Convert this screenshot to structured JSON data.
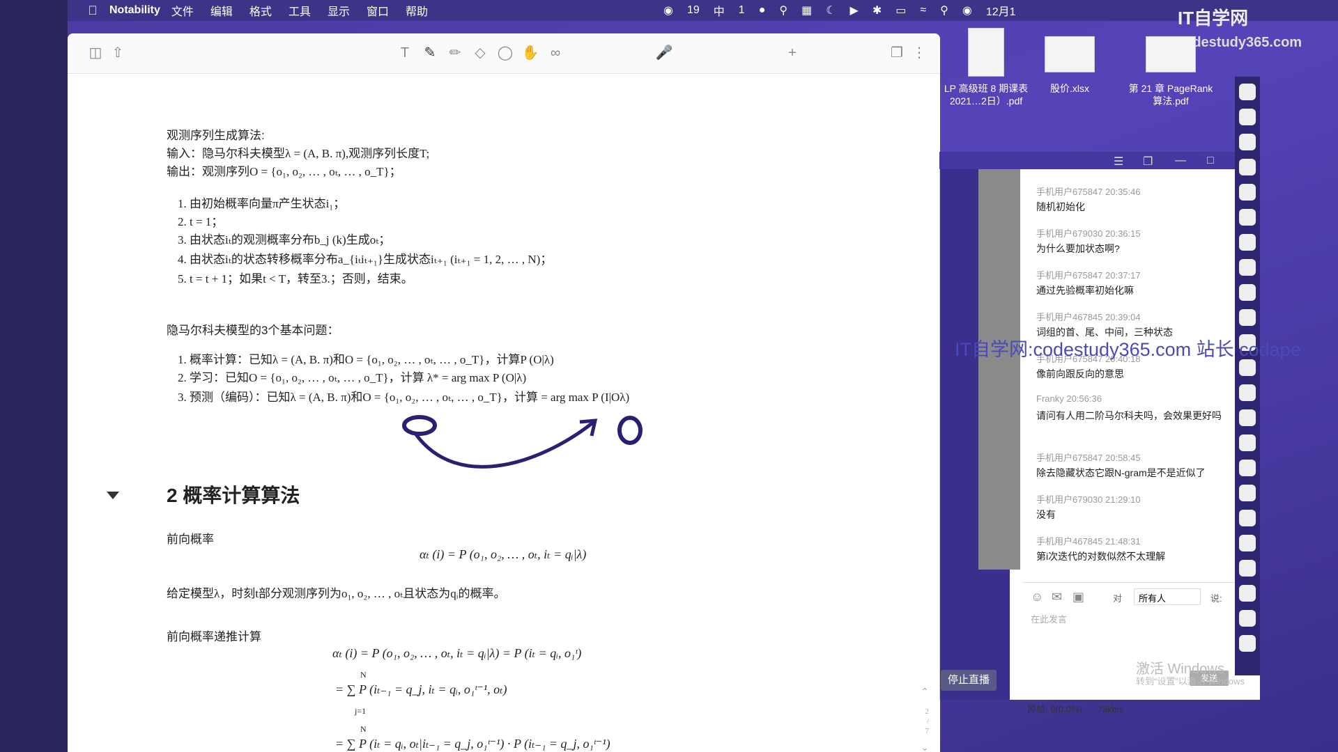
{
  "menubar": {
    "app": "Notability",
    "items": [
      "文件",
      "编辑",
      "格式",
      "工具",
      "显示",
      "窗口",
      "帮助"
    ],
    "status": {
      "wechat": "19",
      "ime": "中",
      "num": "1",
      "date": "12月1"
    }
  },
  "desktop": {
    "files": [
      {
        "name1": "LP 高级班 8 期课表",
        "name2": "2021…2日）.pdf"
      },
      {
        "name1": "股价.xlsx",
        "name2": ""
      },
      {
        "name1": "第 21 章 PageRank",
        "name2": "算法.pdf"
      }
    ]
  },
  "watermark": {
    "logo": "IT自学网",
    "site": "codestudy365.com",
    "overlay": "IT自学网:codestudy365.com 站长 codape"
  },
  "note": {
    "l1": "观测序列生成算法:",
    "l2": "输入：隐马尔科夫模型λ = (A, B. π),观测序列长度T;",
    "l3": "输出：观测序列O = {o₁, o₂, … , oₜ, … , o_T}；",
    "s1": "1. 由初始概率向量π产生状态i₁；",
    "s2": "2. t = 1；",
    "s3": "3. 由状态iₜ的观测概率分布b_j (k)生成oₜ；",
    "s4": "4. 由状态iₜ的状态转移概率分布a_{iₜiₜ₊₁}生成状态iₜ₊₁      (iₜ₊₁ = 1, 2, … , N)；",
    "s5": "5. t = t + 1；如果t < T，转至3.；否则，结束。",
    "p_title": "隐马尔科夫模型的3个基本问题：",
    "p1": "1. 概率计算：已知λ = (A, B. π)和O = {o₁, o₂, … , oₜ, … , o_T}，计算P (O|λ)",
    "p2": "2. 学习：已知O = {o₁, o₂, … , oₜ, … , o_T}，计算 λ* = arg max P (O|λ)",
    "p3": "3. 预测（编码）：已知λ = (A, B. π)和O = {o₁, o₂, … , oₜ, … , o_T}，计算       = arg max P (I|Oλ)",
    "h2": "2 概率计算算法",
    "fwd": "前向概率",
    "fwd_eq": "αₜ (i) = P (o₁, o₂, … , oₜ, iₜ = qᵢ|λ)",
    "fwd_desc": "给定模型λ，时刻t部分观测序列为o₁, o₂, … , oₜ且状态为qᵢ的概率。",
    "rec": "前向概率递推计算",
    "eq1": "αₜ (i) = P (o₁, o₂, … , oₜ, iₜ = qᵢ|λ) = P (iₜ = qᵢ, o₁ᵗ)",
    "eq2": "= ∑ P (iₜ₋₁ = q_j, iₜ = qᵢ, o₁ᵗ⁻¹, oₜ)",
    "eq3": "= ∑ P (iₜ = qᵢ, oₜ|iₜ₋₁ = q_j, o₁ᵗ⁻¹) · P (iₜ₋₁ = q_j, o₁ᵗ⁻¹)",
    "sum_top": "N",
    "sum_bot": "j=1",
    "page_nums": [
      "2",
      "/",
      "7"
    ]
  },
  "chat": {
    "messages": [
      {
        "user": "手机用户675847 20:35:46",
        "text": "随机初始化"
      },
      {
        "user": "手机用户679030 20:36:15",
        "text": "为什么要加状态啊?"
      },
      {
        "user": "手机用户675847 20:37:17",
        "text": "通过先验概率初始化嘛"
      },
      {
        "user": "手机用户467845 20:39:04",
        "text": "词组的首、尾、中间，三种状态"
      },
      {
        "user": "手机用户675847 20:40:18",
        "text": "像前向跟反向的意思"
      },
      {
        "user": "Franky 20:56:36",
        "text": "请问有人用二阶马尔科夫吗，会效果更好吗"
      },
      {
        "user": "手机用户675847 20:58:45",
        "text": "除去隐藏状态它跟N-gram是不是近似了"
      },
      {
        "user": "手机用户679030 21:29:10",
        "text": "没有"
      },
      {
        "user": "手机用户467845 21:48:31",
        "text": "第i次迭代的对数似然不太理解"
      }
    ],
    "to_label": "对",
    "to_value": "所有人",
    "say_label": "说:",
    "input_placeholder": "在此发言",
    "send": "发送",
    "stop_live": "停止直播",
    "stats_drop": "掉帧: 0(0.0%)",
    "stats_rate": "73kb/s",
    "win_act1": "激活 Windows",
    "win_act2": "转到“设置”以激活 Windows"
  }
}
